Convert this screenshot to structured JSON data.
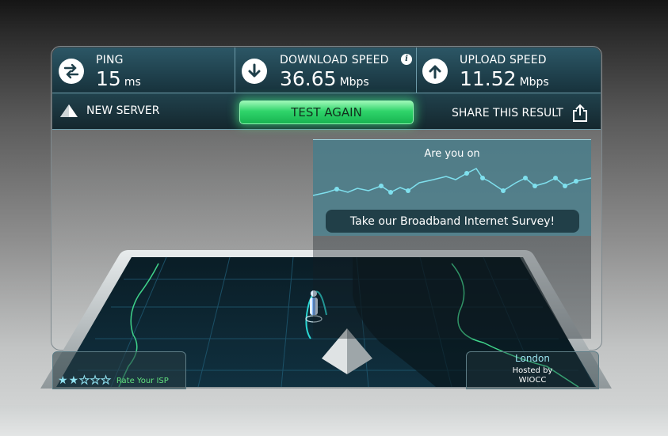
{
  "stats": {
    "ping": {
      "label": "PING",
      "value": "15",
      "unit": "ms",
      "icon": "ping-arrows-icon"
    },
    "download": {
      "label": "DOWNLOAD SPEED",
      "value": "36.65",
      "unit": "Mbps",
      "icon": "download-arrow-icon"
    },
    "upload": {
      "label": "UPLOAD SPEED",
      "value": "11.52",
      "unit": "Mbps",
      "icon": "upload-arrow-icon"
    },
    "info_glyph": "i"
  },
  "actions": {
    "new_server": "NEW SERVER",
    "test_again": "TEST AGAIN",
    "share": "SHARE THIS RESULT"
  },
  "survey": {
    "title": "Are you on",
    "button": "Take our Broadband Internet Survey!"
  },
  "rating": {
    "label": "Rate Your ISP",
    "stars_filled": 2,
    "stars_total": 5,
    "star_glyph": "★"
  },
  "server": {
    "city": "London",
    "hosted_by_label": "Hosted by",
    "host": "WIOCC"
  },
  "colors": {
    "accent_green": "#2fd46a",
    "bar_teal": "#2c5766",
    "map_line": "#3fd38a"
  }
}
